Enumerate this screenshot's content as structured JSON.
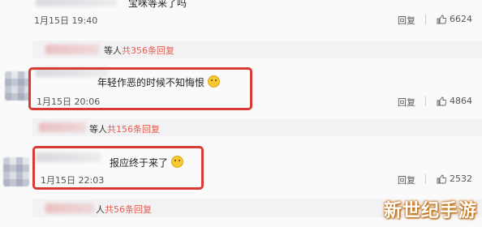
{
  "comments": [
    {
      "text": "宝咪等来了吗",
      "time": "1月15日 19:40",
      "reply_label": "回复",
      "likes": "6624"
    },
    {
      "text": "年轻作恶的时候不知悔恨",
      "time": "1月15日 20:06",
      "reply_label": "回复",
      "likes": "4864"
    },
    {
      "text": "报应终于来了",
      "time": "1月15日 22:03",
      "reply_label": "回复",
      "likes": "2532"
    }
  ],
  "threads": [
    {
      "who": "等人",
      "count": "共356条回复"
    },
    {
      "who": "等人",
      "count": "共156条回复"
    },
    {
      "who": "人",
      "count": "共56条回复"
    }
  ],
  "watermark": "新世纪手游",
  "colors": {
    "highlight_box": "#d93a33",
    "reply_count": "#e65c50"
  }
}
